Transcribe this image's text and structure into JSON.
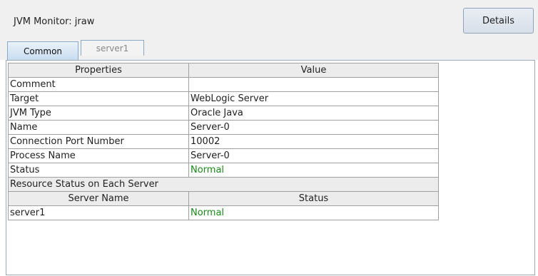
{
  "header": {
    "title": "JVM Monitor: jraw",
    "details_label": "Details"
  },
  "tabs": [
    {
      "label": "Common",
      "active": true
    },
    {
      "label": "server1",
      "active": false
    }
  ],
  "table": {
    "columns": [
      "Properties",
      "Value"
    ],
    "rows": [
      {
        "property": "Comment",
        "value": ""
      },
      {
        "property": "Target",
        "value": "WebLogic Server"
      },
      {
        "property": "JVM Type",
        "value": "Oracle Java"
      },
      {
        "property": "Name",
        "value": "Server-0"
      },
      {
        "property": "Connection Port Number",
        "value": "10002"
      },
      {
        "property": "Process Name",
        "value": "Server-0"
      },
      {
        "property": "Status",
        "value": "Normal"
      }
    ],
    "section_title": "Resource Status on Each Server",
    "server_columns": [
      "Server Name",
      "Status"
    ],
    "servers": [
      {
        "name": "server1",
        "status": "Normal"
      }
    ]
  },
  "colors": {
    "status_normal": "#1a8a1a",
    "tab_active": "#c8dcf0"
  }
}
